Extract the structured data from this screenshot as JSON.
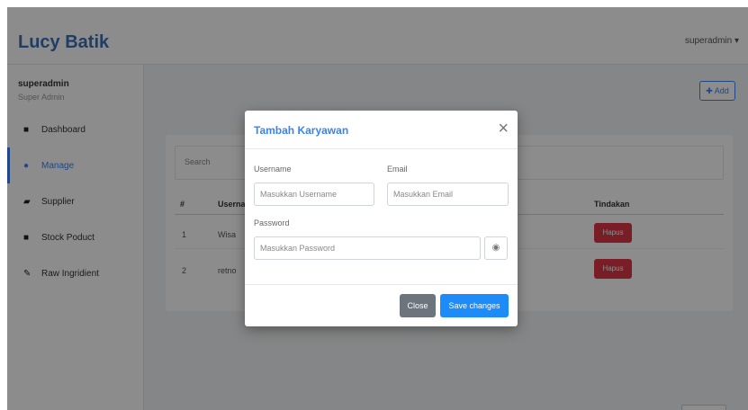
{
  "app": {
    "brand": "Lucy Batik",
    "user_menu": "superadmin ▾"
  },
  "sidebar": {
    "user_name": "superadmin",
    "user_role": "Super Admin",
    "items": [
      {
        "icon": "dashboard-icon",
        "glyph": "■",
        "label": "Dashboard"
      },
      {
        "icon": "user-icon",
        "glyph": "●",
        "label": "Manage"
      },
      {
        "icon": "truck-icon",
        "glyph": "▰",
        "label": "Supplier"
      },
      {
        "icon": "box-icon",
        "glyph": "■",
        "label": "Stock Poduct"
      },
      {
        "icon": "brush-icon",
        "glyph": "✎",
        "label": "Raw Ingridient"
      }
    ]
  },
  "main": {
    "add_button": "✚ Add",
    "search_label": "Search",
    "table": {
      "headers": [
        "#",
        "Username",
        "Tindakan"
      ],
      "rows": [
        {
          "no": "1",
          "username": "Wisa",
          "action": "Hapus"
        },
        {
          "no": "2",
          "username": "retno",
          "action": "Hapus"
        }
      ]
    }
  },
  "modal": {
    "title": "Tambah Karyawan",
    "close_symbol": "×",
    "username_label": "Username",
    "username_placeholder": "Masukkan Username",
    "email_label": "Email",
    "email_placeholder": "Masukkan Email",
    "password_label": "Password",
    "password_placeholder": "Masukkan Password",
    "eye_glyph": "◉",
    "close_button": "Close",
    "save_button": "Save changes"
  },
  "colors": {
    "brand": "#3b6fb6",
    "primary": "#1d8cf8",
    "danger": "#dc3545",
    "secondary": "#6c757d"
  }
}
